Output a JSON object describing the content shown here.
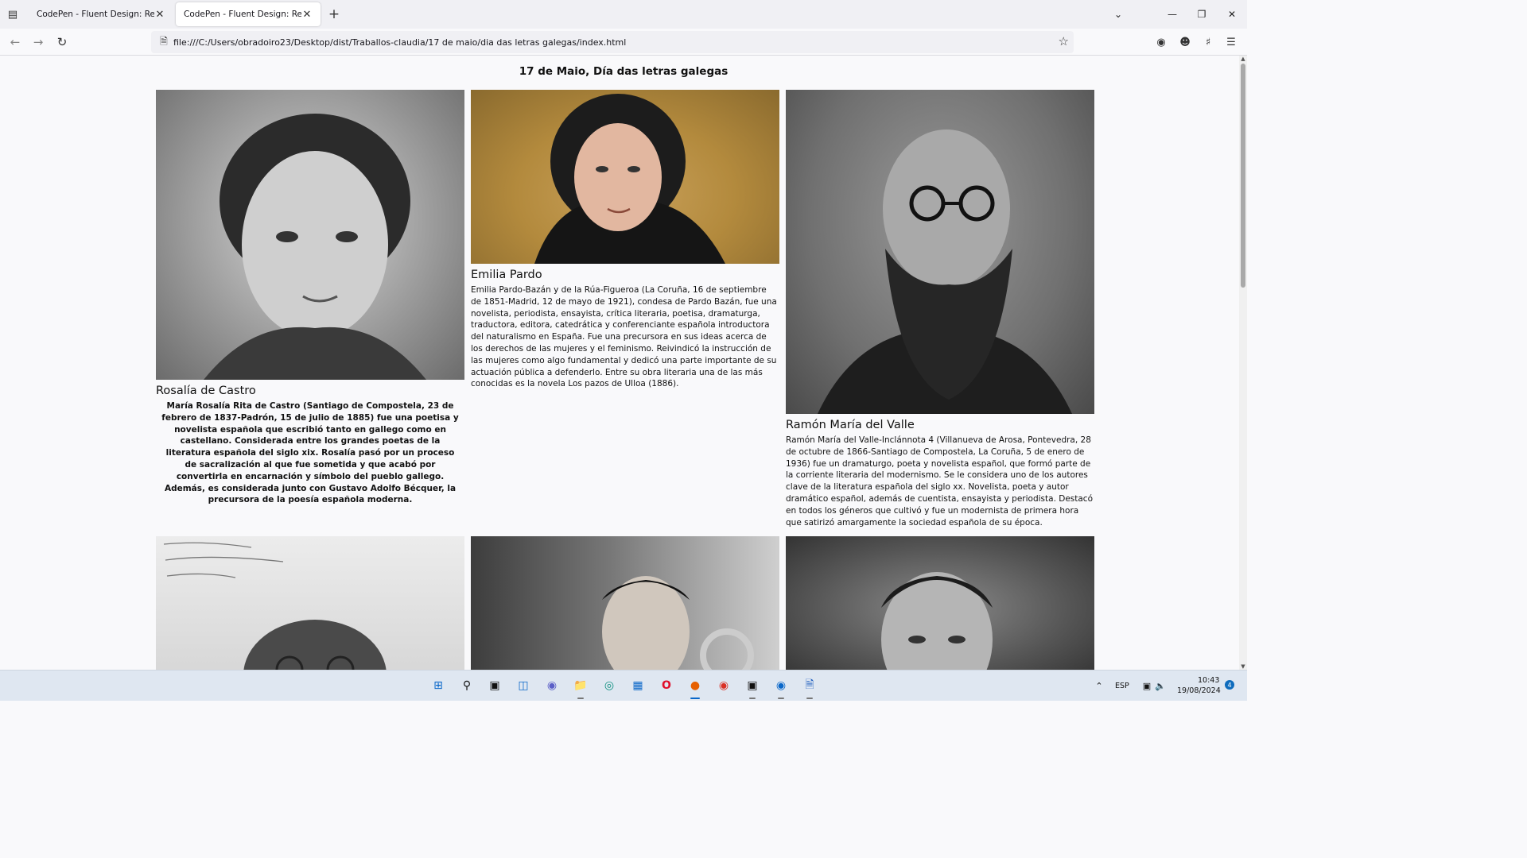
{
  "browser": {
    "tabs": [
      {
        "title": "CodePen - Fluent Design: Rebuild",
        "active": false
      },
      {
        "title": "CodePen - Fluent Design: Rebuild",
        "active": true
      }
    ],
    "url": "file:///C:/Users/obradoiro23/Desktop/dist/Traballos-claudia/17 de maio/dia das letras galegas/index.html"
  },
  "page": {
    "title": "17 de Maio, Día das letras galegas",
    "cards": [
      {
        "name": "Rosalía de Castro",
        "bio": "María Rosalía Rita de Castro (Santiago de Compostela, 23 de febrero de 1837-Padrón, 15 de julio de 1885) fue una poetisa y novelista española que escribió tanto en gallego como en castellano. Considerada entre los grandes poetas de la literatura española del siglo xix. Rosalía pasó por un proceso de sacralización al que fue sometida y que acabó por convertirla en encarnación y símbolo del pueblo gallego. Además, es considerada junto con Gustavo Adolfo Bécquer, la precursora de la poesía española moderna."
      },
      {
        "name": "Emilia Pardo",
        "bio": "Emilia Pardo-Bazán y de la Rúa-Figueroa (La Coruña, 16 de septiembre de 1851-Madrid, 12 de mayo de 1921), condesa de Pardo Bazán, fue una novelista, periodista, ensayista, crítica literaria, poetisa, dramaturga, traductora, editora, catedrática y conferenciante española introductora del naturalismo en España. Fue una precursora en sus ideas acerca de los derechos de las mujeres y el feminismo. Reivindicó la instrucción de las mujeres como algo fundamental y dedicó una parte importante de su actuación pública a defenderlo. Entre su obra literaria una de las más conocidas es la novela Los pazos de Ulloa (1886)."
      },
      {
        "name": "Ramón María del Valle",
        "bio": "Ramón María del Valle-Inclánnota 4 (Villanueva de Arosa, Pontevedra, 28 de octubre de 1866-Santiago de Compostela, La Coruña, 5 de enero de 1936) fue un dramaturgo, poeta y novelista español, que formó parte de la corriente literaria del modernismo. Se le considera uno de los autores clave de la literatura española del siglo xx. Novelista, poeta y autor dramático español, además de cuentista, ensayista y periodista. Destacó en todos los géneros que cultivó y fue un modernista de primera hora que satirizó amargamente la sociedad española de su época."
      }
    ]
  },
  "taskbar": {
    "language": "ESP",
    "time": "10:43",
    "date": "19/08/2024",
    "notifications": "4"
  }
}
